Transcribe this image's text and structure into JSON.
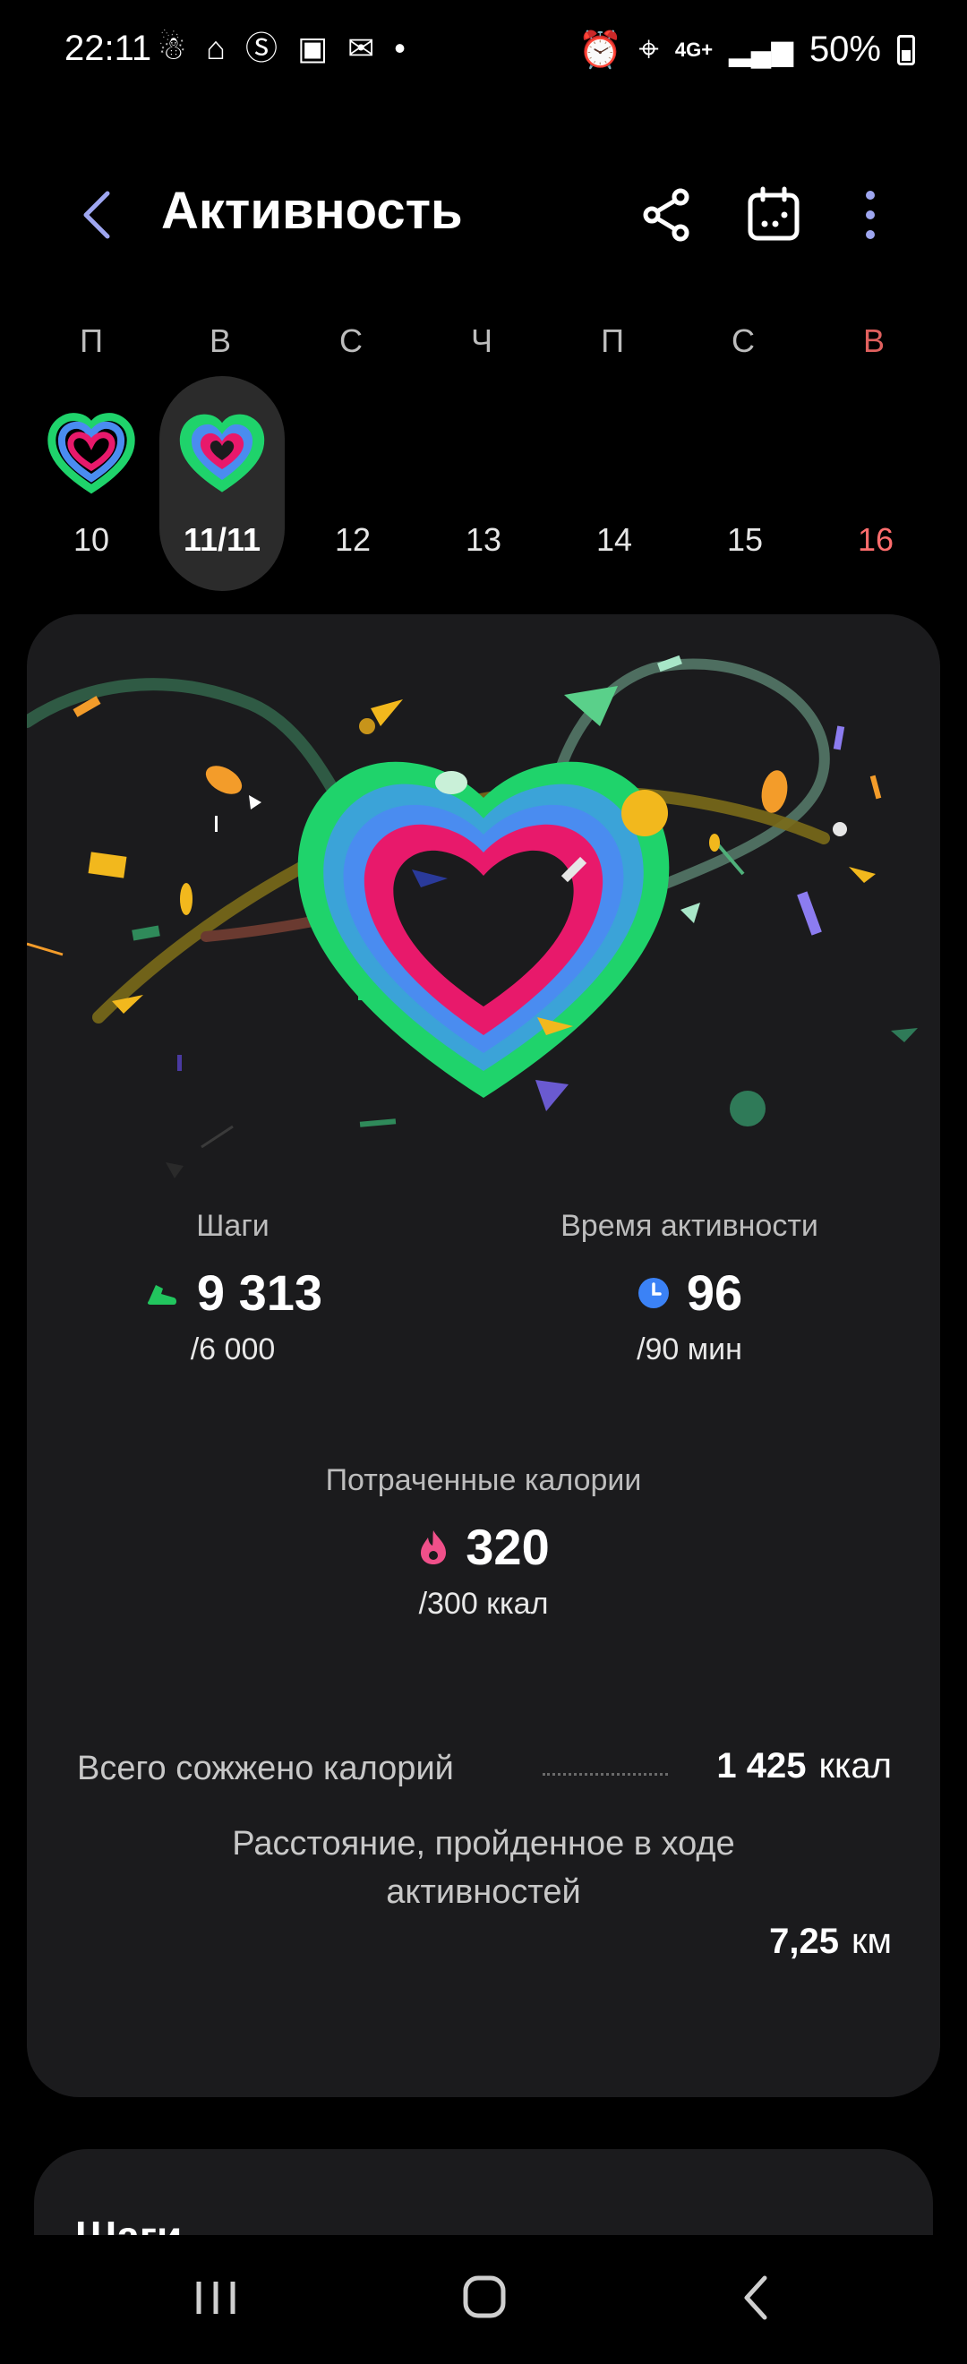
{
  "status_bar": {
    "time": "22:11",
    "battery": "50%",
    "network": "4G+"
  },
  "header": {
    "title": "Активность"
  },
  "week": {
    "weekdays": [
      "П",
      "В",
      "С",
      "Ч",
      "П",
      "С",
      "В"
    ],
    "dates": [
      "10",
      "11/11",
      "12",
      "13",
      "14",
      "15",
      "16"
    ],
    "selected_index": 1,
    "weekend_color": "#ff6d6d"
  },
  "stats": {
    "steps": {
      "label": "Шаги",
      "value": "9 313",
      "goal": "/6 000"
    },
    "active_time": {
      "label": "Время активности",
      "value": "96",
      "goal": "/90 мин"
    },
    "calories": {
      "label": "Потраченные калории",
      "value": "320",
      "goal": "/300 ккал"
    }
  },
  "totals": {
    "burned_label": "Всего сожжено калорий",
    "burned_value": "1 425",
    "burned_unit": "ккал",
    "distance_label": "Расстояние, пройденное в ходе активностей",
    "distance_value": "7,25",
    "distance_unit": "км"
  },
  "steps_card": {
    "title": "Шаги"
  },
  "colors": {
    "ring_green": "#1fd36b",
    "ring_blue": "#4a8cf0",
    "ring_pink": "#e8196b",
    "steps_icon": "#22c55e",
    "time_icon": "#3b82f6",
    "cal_icon": "#f0508a"
  },
  "icons": [
    "back-arrow-icon",
    "share-icon",
    "calendar-icon",
    "more-icon",
    "shoe-icon",
    "clock-icon",
    "flame-icon"
  ]
}
